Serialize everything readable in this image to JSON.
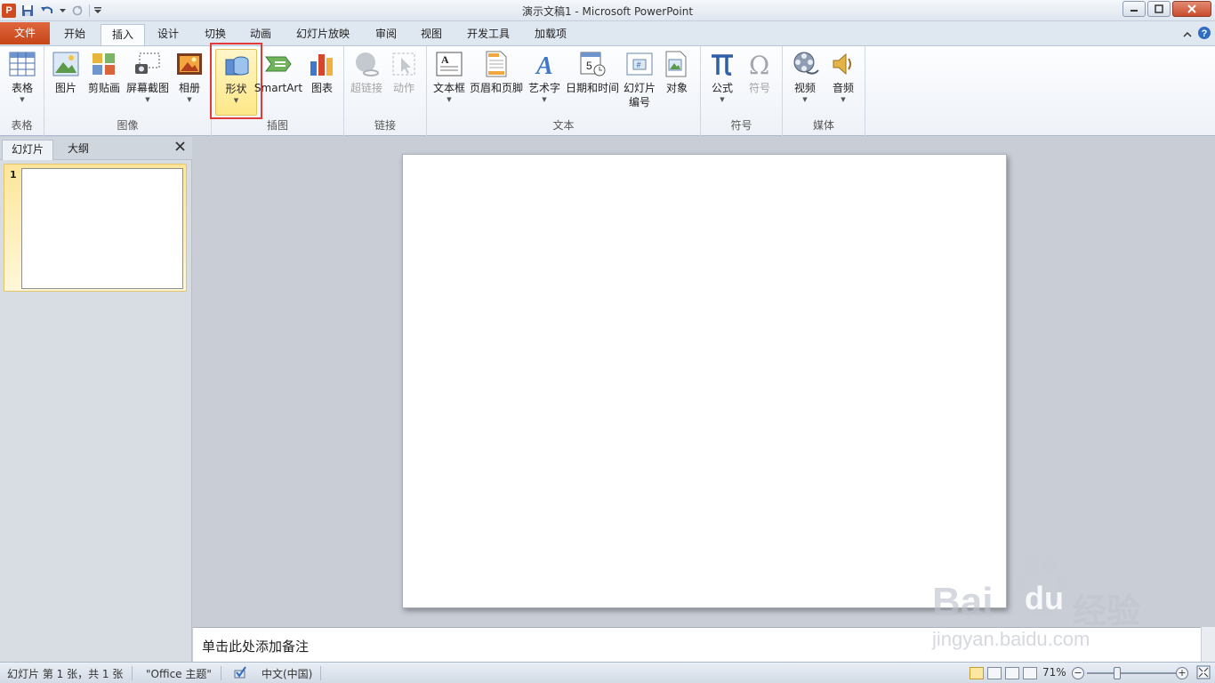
{
  "window": {
    "title": "演示文稿1 - Microsoft PowerPoint",
    "app_icon_letter": "P"
  },
  "ribbon_tabs": {
    "file": "文件",
    "items": [
      "开始",
      "插入",
      "设计",
      "切换",
      "动画",
      "幻灯片放映",
      "审阅",
      "视图",
      "开发工具",
      "加载项"
    ],
    "active": "插入"
  },
  "ribbon": {
    "groups": {
      "table": "表格",
      "images": "图像",
      "illustrations": "插图",
      "links": "链接",
      "text": "文本",
      "symbols": "符号",
      "media": "媒体"
    },
    "buttons": {
      "table": "表格",
      "picture": "图片",
      "clipart": "剪贴画",
      "screenshot": "屏幕截图",
      "album": "相册",
      "shapes": "形状",
      "smartart": "SmartArt",
      "chart": "图表",
      "hyperlink": "超链接",
      "action": "动作",
      "textbox": "文本框",
      "header_footer": "页眉和页脚",
      "wordart": "艺术字",
      "datetime": "日期和时间",
      "slide_number_line1": "幻灯片",
      "slide_number_line2": "编号",
      "object": "对象",
      "equation": "公式",
      "symbol": "符号",
      "video": "视频",
      "audio": "音频"
    }
  },
  "left_panel": {
    "tabs": [
      "幻灯片",
      "大纲"
    ],
    "active_tab": "幻灯片",
    "slides": [
      {
        "number": "1"
      }
    ]
  },
  "notes": {
    "placeholder": "单击此处添加备注"
  },
  "status_bar": {
    "slide_info": "幻灯片 第 1 张，共 1 张",
    "theme": "\"Office 主题\"",
    "language": "中文(中国)",
    "zoom": "71%"
  },
  "watermark": {
    "brand": "Bai",
    "brand2": "du",
    "cn": "经验",
    "url": "jingyan.baidu.com"
  },
  "colors": {
    "accent_file_tab": "#c74517",
    "highlight_border": "#e03a3a"
  }
}
